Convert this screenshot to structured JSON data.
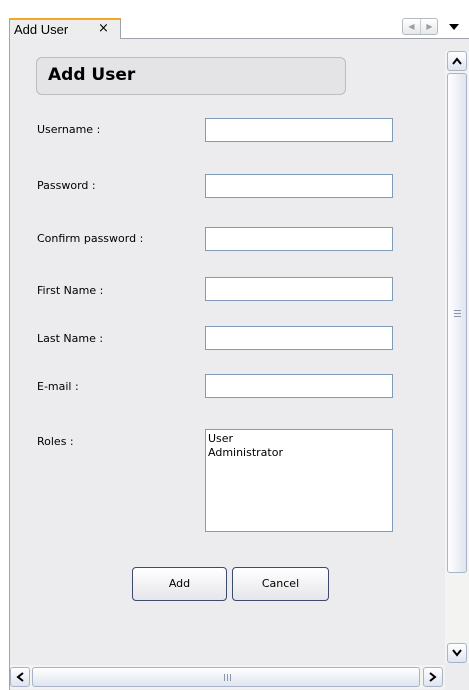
{
  "tab": {
    "label": "Add User",
    "close_glyph": "×",
    "nav_left_glyph": "◀",
    "nav_right_glyph": "▶"
  },
  "form": {
    "title": "Add User",
    "fields": [
      {
        "label": "Username :",
        "value": ""
      },
      {
        "label": "Password :",
        "value": ""
      },
      {
        "label": "Confirm password :",
        "value": ""
      },
      {
        "label": "First Name :",
        "value": ""
      },
      {
        "label": "Last Name :",
        "value": ""
      },
      {
        "label": "E-mail :",
        "value": ""
      }
    ],
    "roles_label": "Roles :",
    "roles": [
      "User",
      "Administrator"
    ]
  },
  "buttons": {
    "add_label": "Add",
    "cancel_label": "Cancel"
  },
  "icons": {
    "close": "close-icon",
    "nav_left": "chevron-left-icon",
    "nav_right": "chevron-right-icon",
    "dropdown": "chevron-down-icon",
    "scroll_up": "arrow-up-icon",
    "scroll_down": "arrow-down-icon",
    "scroll_left": "arrow-left-icon",
    "scroll_right": "arrow-right-icon"
  },
  "colors": {
    "active_tab_accent": "#f5a623",
    "panel_background": "#ececee",
    "input_border": "#7f9db9"
  }
}
